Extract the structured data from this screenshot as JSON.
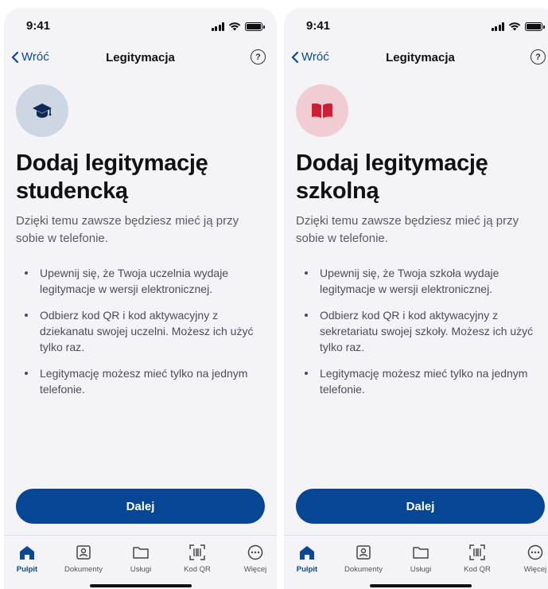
{
  "status_bar": {
    "time": "9:41"
  },
  "nav": {
    "back_label": "Wróć",
    "title": "Legitymacja",
    "help_symbol": "?"
  },
  "icons": {
    "back": "chevron-left-icon",
    "help": "question-circle-icon",
    "student": "graduation-cap-icon",
    "school": "open-book-icon"
  },
  "colors": {
    "primary": "#064695",
    "accent_link": "#0b4a92",
    "background": "#f3f3f8",
    "student_icon_bg": "#ccd7e3",
    "school_icon_bg": "#f2ccd3",
    "school_icon": "#cc1f36"
  },
  "screens": [
    {
      "heading_line1": "Dodaj legitymację",
      "heading_line2": "studencką",
      "intro": "Dzięki temu zawsze będziesz mieć ją przy sobie w telefonie.",
      "bullets": [
        "Upewnij się, że Twoja uczelnia wydaje legitymacje w wersji elektronicznej.",
        "Odbierz kod QR i kod aktywacyjny z dziekanatu swojej uczelni. Możesz ich użyć tylko raz.",
        "Legitymację możesz mieć tylko na jednym telefonie."
      ],
      "cta_label": "Dalej"
    },
    {
      "heading_line1": "Dodaj legitymację",
      "heading_line2": "szkolną",
      "intro": "Dzięki temu zawsze będziesz mieć ją przy sobie w telefonie.",
      "bullets": [
        "Upewnij się, że Twoja szkoła wydaje legitymacje w wersji elektronicznej.",
        "Odbierz kod QR i kod aktywacyjny z sekretariatu swojej szkoły. Możesz ich użyć tylko raz.",
        "Legitymację możesz mieć tylko na jednym telefonie."
      ],
      "cta_label": "Dalej"
    }
  ],
  "tab_bar": {
    "active_index": 0,
    "items": [
      {
        "label": "Pulpit",
        "icon": "home-icon"
      },
      {
        "label": "Dokumenty",
        "icon": "id-card-icon"
      },
      {
        "label": "Usługi",
        "icon": "folder-icon"
      },
      {
        "label": "Kod QR",
        "icon": "qr-scan-icon"
      },
      {
        "label": "Więcej",
        "icon": "more-icon"
      }
    ]
  }
}
